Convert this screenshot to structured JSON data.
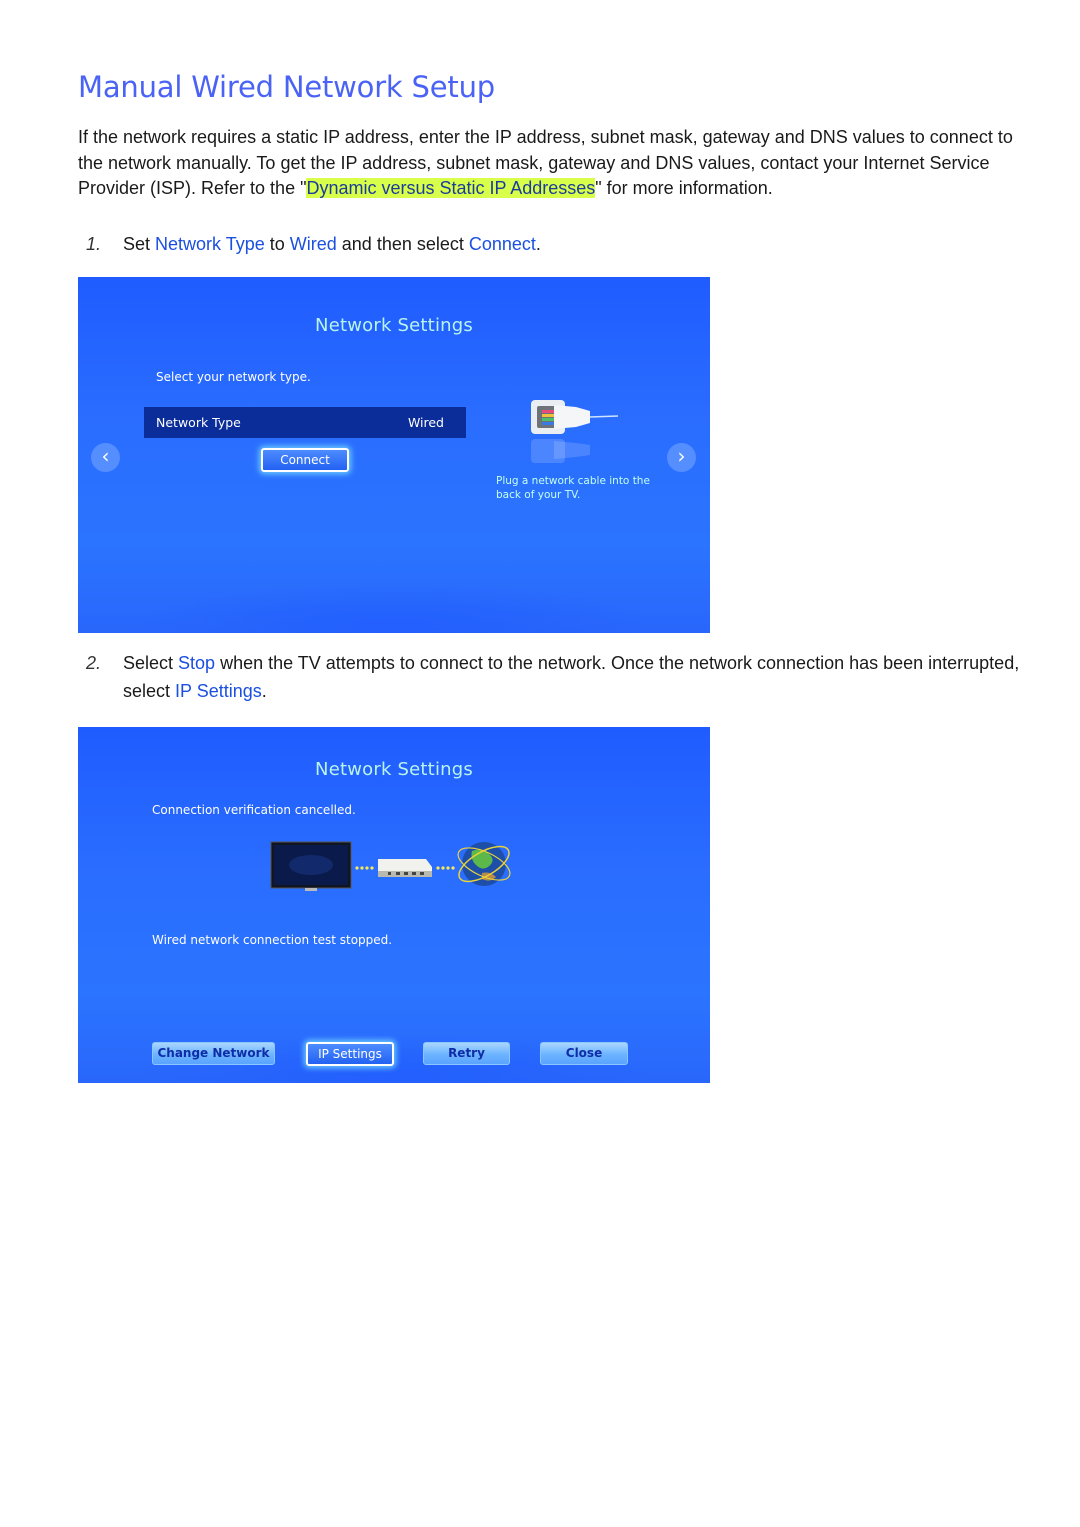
{
  "page": {
    "title": "Manual Wired Network Setup",
    "intro": {
      "before": "If the network requires a static IP address, enter the IP address, subnet mask, gateway and DNS values to connect to the network manually. To get the IP address, subnet mask, gateway and DNS values, contact your Internet Service Provider (ISP). Refer to the \"",
      "link": "Dynamic versus Static IP Addresses",
      "after": "\" for more information."
    },
    "colors": {
      "title": "#4a63f5",
      "keyword": "#1a4fe0",
      "highlight": "#d8ff4a",
      "tv_background": "#2a6dff"
    }
  },
  "steps": [
    {
      "number": "1.",
      "parts": {
        "t0": "Set ",
        "k0": "Network Type",
        "t1": " to ",
        "k1": "Wired",
        "t2": " and then select ",
        "k2": "Connect",
        "t3": "."
      }
    },
    {
      "number": "2.",
      "parts": {
        "t0": "Select ",
        "k0": "Stop",
        "t1": " when the TV attempts to connect to the network. Once the network connection has been interrupted, select ",
        "k1": "IP Settings",
        "t2": "."
      }
    }
  ],
  "screen1": {
    "title": "Network Settings",
    "prompt": "Select your network type.",
    "network_type_label": "Network Type",
    "network_type_value": "Wired",
    "connect_button": "Connect",
    "prev_arrow": "‹",
    "next_arrow": "›",
    "illustration": "ethernet-plug-icon",
    "hint": "Plug a network cable into the back of your TV."
  },
  "screen2": {
    "title": "Network Settings",
    "status": "Connection verification cancelled.",
    "illustration": [
      "tv-icon",
      "router-icon",
      "globe-icon"
    ],
    "result": "Wired network connection test stopped.",
    "buttons": {
      "change_network": "Change Network",
      "ip_settings": "IP Settings",
      "retry": "Retry",
      "close": "Close"
    }
  }
}
